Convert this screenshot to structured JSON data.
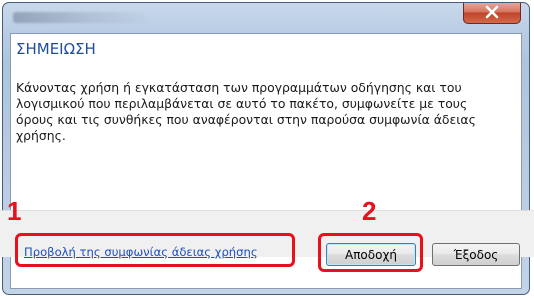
{
  "dialog": {
    "heading": "ΣΗΜΕΙΩΣΗ",
    "message": "Κάνοντας χρήση ή εγκατάσταση των προγραμμάτων οδήγησης και του λογισμικού που περιλαμβάνεται σε αυτό το πακέτο, συμφωνείτε με τους όρους και τις συνθήκες που αναφέρονται στην παρούσα συμφωνία άδειας χρήσης.",
    "license_link": "Προβολή της συμφωνίας άδειας χρήσης",
    "accept_label": "Αποδοχή",
    "exit_label": "Έξοδος"
  },
  "callouts": {
    "step1": "1",
    "step2": "2"
  },
  "icons": {
    "close": "close-icon"
  },
  "colors": {
    "highlight": "#e8101c",
    "heading": "#1f4d9a",
    "link": "#1c4fbf",
    "close_button": "#c0432b"
  }
}
